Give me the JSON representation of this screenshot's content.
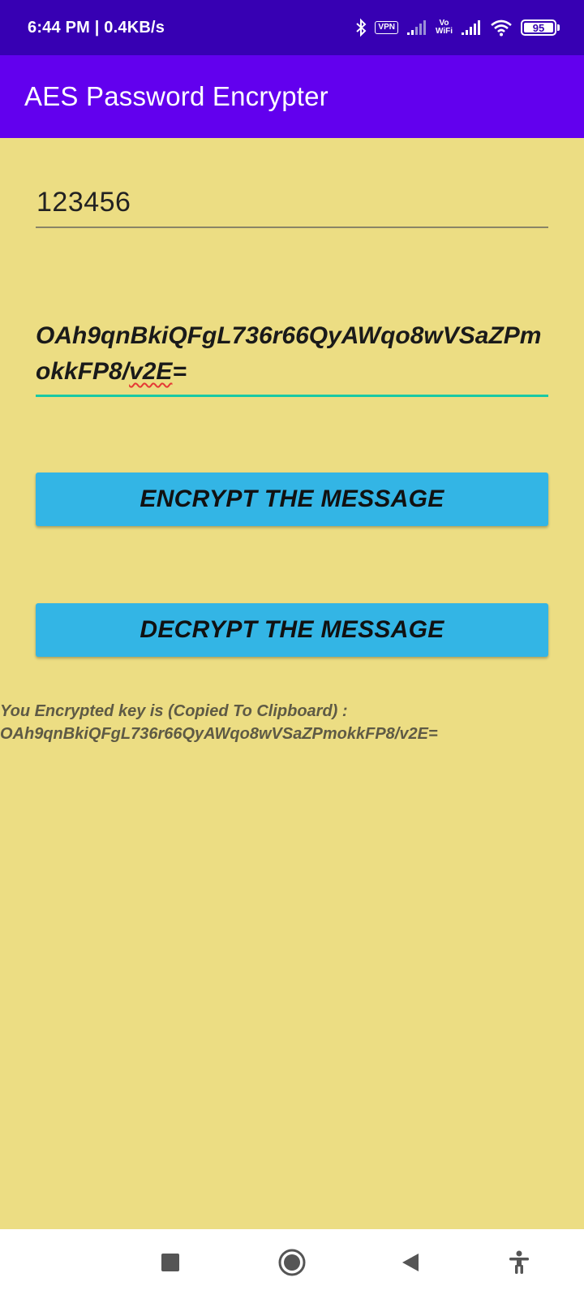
{
  "status_bar": {
    "time": "6:44 PM | 0.4KB/s",
    "vpn_label": "VPN",
    "vowifi_top": "Vo",
    "vowifi_bottom": "WiFi",
    "battery": "95",
    "icons": [
      "bluetooth-icon",
      "vpn-icon",
      "signal-icon",
      "vowifi-icon",
      "signal-icon",
      "wifi-icon",
      "battery-icon"
    ]
  },
  "app_bar": {
    "title": "AES Password Encrypter"
  },
  "form": {
    "plain_input_value": "123456",
    "result_input_value_main": "OAh9qnBkiQFgL736r66QyAWqo8wVSaZPmokkFP8/",
    "result_input_value_flagged": "v2E",
    "result_input_value_tail": "="
  },
  "buttons": {
    "encrypt_label": "ENCRYPT THE MESSAGE",
    "decrypt_label": "DECRYPT THE MESSAGE"
  },
  "result": {
    "line1": "You Encrypted key is (Copied To Clipboard) :",
    "line2": "OAh9qnBkiQFgL736r66QyAWqo8wVSaZPmokkFP8/v2E="
  },
  "nav_bar": {
    "icons": [
      "recents-icon",
      "home-icon",
      "back-icon",
      "accessibility-icon"
    ]
  },
  "colors": {
    "status_bar": "#3700b3",
    "app_bar": "#6200ee",
    "background": "#ecdd83",
    "button": "#33b5e5",
    "focus_underline": "#19c9a4"
  }
}
